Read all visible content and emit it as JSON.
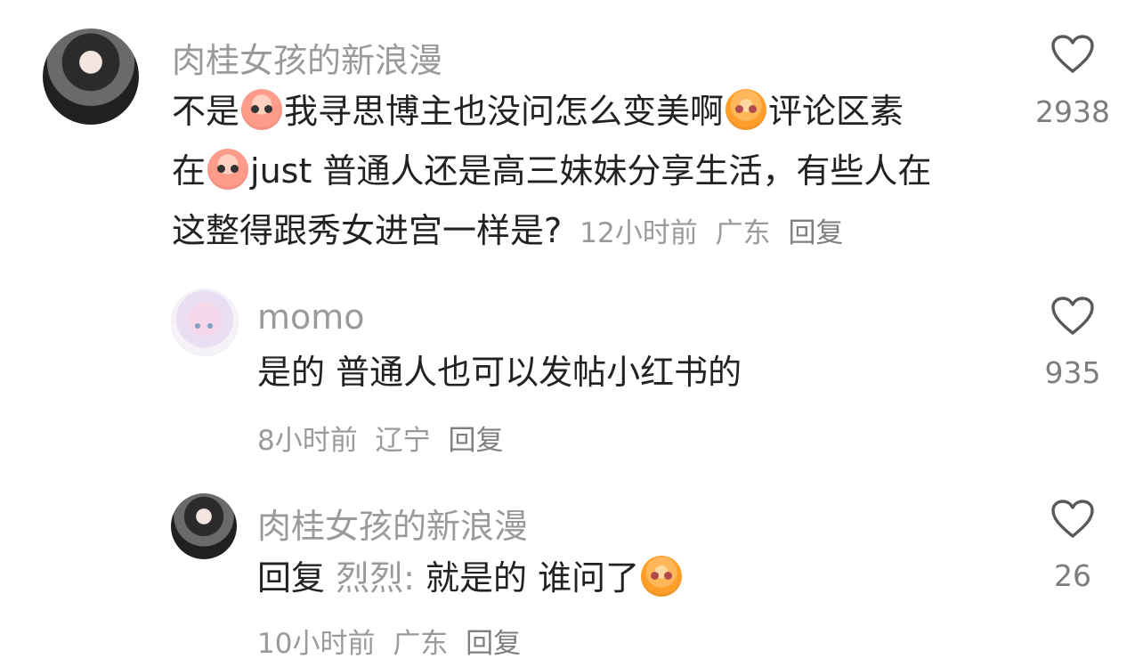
{
  "comments": [
    {
      "username": "肉桂女孩的新浪漫",
      "line1_a": "不是",
      "line1_b": "我寻思博主也没问怎么变美啊",
      "line1_c": "评论区素",
      "line2_a": "在",
      "line2_b": "just 普通人还是高三妹妹分享生活，有些人在",
      "line3": "这整得跟秀女进宫一样是?",
      "time": "12小时前",
      "location": "广东",
      "reply": "回复",
      "likes": "2938",
      "emojis": [
        "sweat-face-emoji",
        "happy-face-emoji",
        "sweat-face-emoji"
      ]
    },
    {
      "username": "momo",
      "text": "是的 普通人也可以发帖小红书的",
      "time": "8小时前",
      "location": "辽宁",
      "reply": "回复",
      "likes": "935"
    },
    {
      "username": "肉桂女孩的新浪漫",
      "reply_prefix": "回复",
      "reply_to": "烈烈:",
      "text": "就是的 谁问了",
      "time": "10小时前",
      "location": "广东",
      "reply": "回复",
      "likes": "26",
      "emojis": [
        "happy-face-emoji"
      ]
    }
  ],
  "icons": {
    "like": "heart-outline-icon"
  },
  "colors": {
    "name": "#9a9a9a",
    "text": "#222222",
    "meta": "#9a9a9a",
    "background": "#ffffff"
  }
}
